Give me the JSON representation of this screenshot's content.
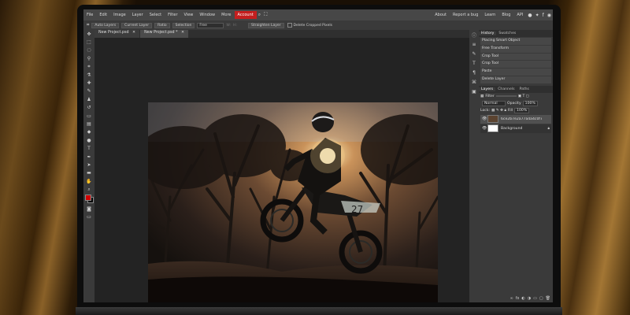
{
  "menu": {
    "items": [
      "File",
      "Edit",
      "Image",
      "Layer",
      "Select",
      "Filter",
      "View",
      "Window",
      "More"
    ],
    "account": "Account",
    "right_links": [
      "About",
      "Report a bug",
      "Learn",
      "Blog",
      "API"
    ]
  },
  "options": {
    "autoselect": "Auto Layers",
    "current_layer": "Current Layer",
    "buttons": [
      "Ratio",
      "Selection"
    ],
    "mode": "Free",
    "w": "W:",
    "h": "H:",
    "straighten": "Straighten Layer",
    "delete_cropped": "Delete Cropped Pixels"
  },
  "doc_tabs": [
    "New Project.psd",
    "New Project.psd *"
  ],
  "right_panel": {
    "tabs": [
      "History",
      "Swatches"
    ],
    "history": [
      "Placing Smart Object",
      "Free Transform",
      "Crop Tool",
      "Crop Tool",
      "Paste",
      "Delete Layer"
    ],
    "layer_tabs": [
      "Layers",
      "Channels",
      "Paths"
    ],
    "filter": "Filter",
    "blend": "Normal",
    "opacity_label": "Opacity",
    "opacity": "100%",
    "lock_label": "Lock:",
    "fill_label": "Fill",
    "fill": "100%",
    "layers": [
      {
        "name": "6ce2b7e2a77a4a4c0f7c1d9b5",
        "selected": true
      },
      {
        "name": "Background",
        "selected": false
      }
    ]
  },
  "colors": {
    "accent": "#c41e1e",
    "foreground": "#d10000",
    "background": "#000000"
  }
}
